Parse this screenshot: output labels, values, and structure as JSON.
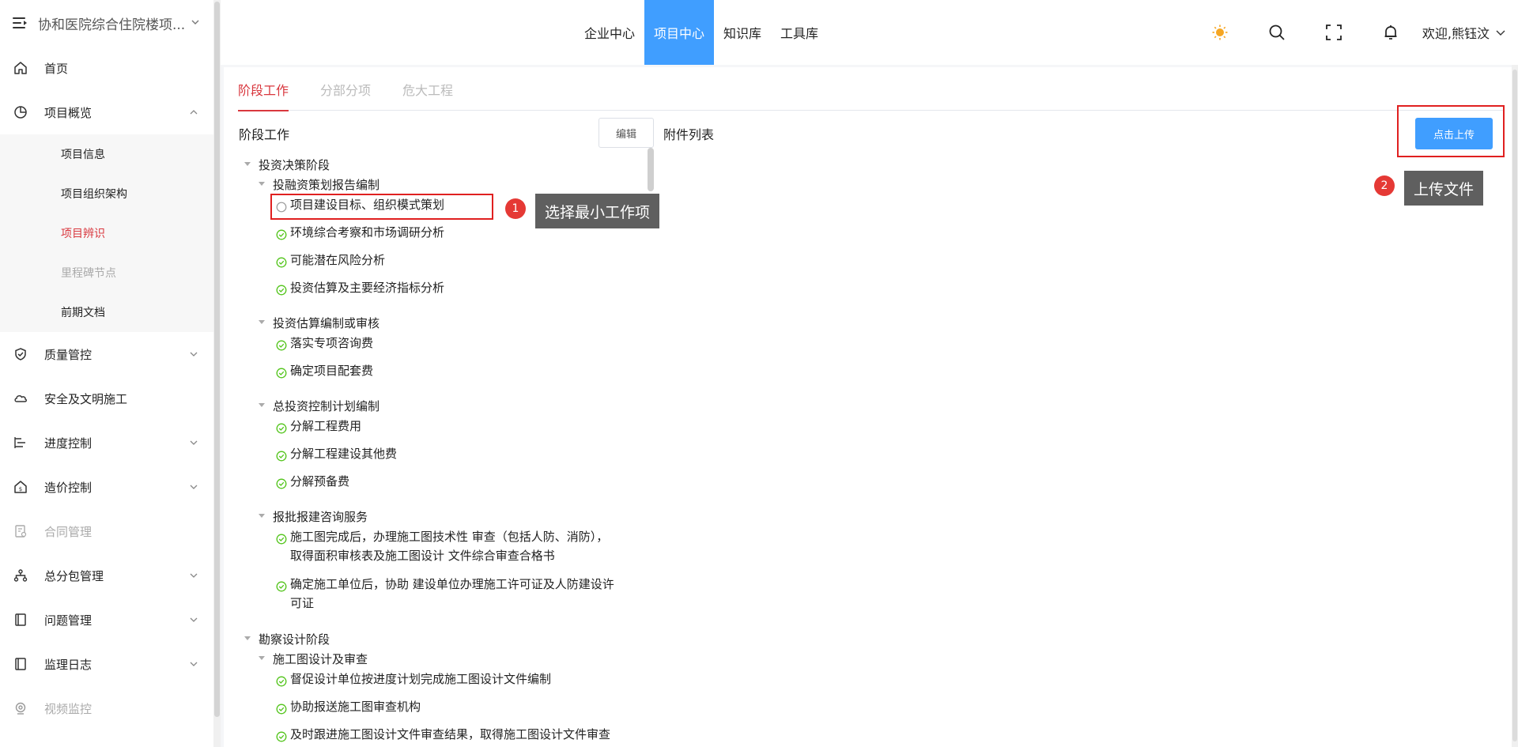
{
  "sidebar": {
    "title": "协和医院综合住院楼项...",
    "items": [
      {
        "label": "首页",
        "icon": "home-icon"
      },
      {
        "label": "项目概览",
        "icon": "pie-chart-icon"
      },
      {
        "label": "质量管控",
        "icon": "shield-check-icon"
      },
      {
        "label": "安全及文明施工",
        "icon": "cloud-icon"
      },
      {
        "label": "进度控制",
        "icon": "progress-icon"
      },
      {
        "label": "造价控制",
        "icon": "house-dollar-icon"
      },
      {
        "label": "合同管理",
        "icon": "contract-icon"
      },
      {
        "label": "总分包管理",
        "icon": "org-tree-icon"
      },
      {
        "label": "问题管理",
        "icon": "book-icon"
      },
      {
        "label": "监理日志",
        "icon": "log-icon"
      },
      {
        "label": "视频监控",
        "icon": "camera-icon"
      }
    ],
    "submenu": [
      "项目信息",
      "项目组织架构",
      "项目辨识",
      "里程碑节点",
      "前期文档"
    ]
  },
  "topnav": {
    "tabs": [
      "企业中心",
      "项目中心",
      "知识库",
      "工具库"
    ],
    "active_index": 1
  },
  "header": {
    "welcome": "欢迎,熊钰汶"
  },
  "tabs": [
    "阶段工作",
    "分部分项",
    "危大工程"
  ],
  "left_panel": {
    "title": "阶段工作",
    "edit_label": "编辑"
  },
  "right_panel": {
    "title": "附件列表",
    "upload_label": "点击上传"
  },
  "tree": [
    {
      "label": "投资决策阶段",
      "level": 0
    },
    {
      "label": "投融资策划报告编制",
      "level": 1
    },
    {
      "label": "项目建设目标、组织模式策划",
      "level": 2,
      "done": false
    },
    {
      "label": "环境综合考察和市场调研分析",
      "level": 2,
      "done": true
    },
    {
      "label": "可能潜在风险分析",
      "level": 2,
      "done": true
    },
    {
      "label": "投资估算及主要经济指标分析",
      "level": 2,
      "done": true
    },
    {
      "label": "投资估算编制或审核",
      "level": 1
    },
    {
      "label": "落实专项咨询费",
      "level": 2,
      "done": true
    },
    {
      "label": "确定项目配套费",
      "level": 2,
      "done": true
    },
    {
      "label": "总投资控制计划编制",
      "level": 1
    },
    {
      "label": "分解工程费用",
      "level": 2,
      "done": true
    },
    {
      "label": "分解工程建设其他费",
      "level": 2,
      "done": true
    },
    {
      "label": "分解预备费",
      "level": 2,
      "done": true
    },
    {
      "label": "报批报建咨询服务",
      "level": 1
    },
    {
      "label": "施工图完成后，办理施工图技术性  审查（包括人防、消防），取得面积审核表及施工图设计  文件综合审查合格书",
      "level": 2,
      "done": true
    },
    {
      "label": "确定施工单位后，协助  建设单位办理施工许可证及人防建设许可证",
      "level": 2,
      "done": true
    },
    {
      "label": "勘察设计阶段",
      "level": 0
    },
    {
      "label": "施工图设计及审查",
      "level": 1
    },
    {
      "label": "督促设计单位按进度计划完成施工图设计文件编制",
      "level": 2,
      "done": true
    },
    {
      "label": "协助报送施工图审查机构",
      "level": 2,
      "done": true
    },
    {
      "label": "及时跟进施工图设计文件审查结果，取得施工图设计文件审查",
      "level": 2,
      "done": true
    }
  ],
  "annotations": [
    {
      "number": "1",
      "text": "选择最小工作项"
    },
    {
      "number": "2",
      "text": "上传文件"
    }
  ],
  "colors": {
    "accent": "#409eff",
    "active_red": "#d9373e",
    "annotation_red": "#e02020",
    "done_green": "#52c41a",
    "tooltip_bg": "#5f5f5f"
  }
}
